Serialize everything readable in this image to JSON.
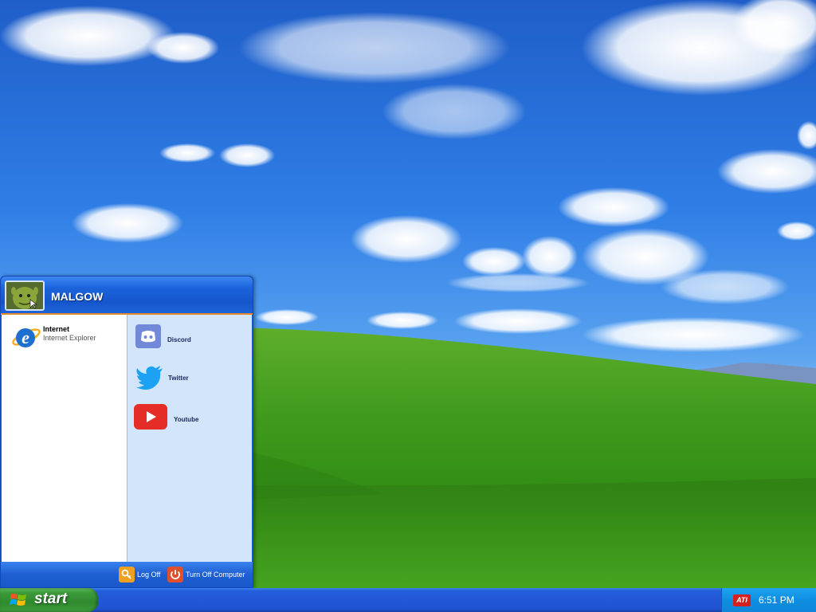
{
  "start_menu": {
    "user_name": "MALGOW",
    "pinned": [
      {
        "title": "Internet",
        "subtitle": "Internet Explorer",
        "icon": "internet-explorer-icon"
      }
    ],
    "links": [
      {
        "label": "Discord",
        "icon": "discord-icon"
      },
      {
        "label": "Twitter",
        "icon": "twitter-icon"
      },
      {
        "label": "Youtube",
        "icon": "youtube-icon"
      }
    ],
    "footer": {
      "log_off_label": "Log Off",
      "turn_off_label": "Turn Off Computer"
    }
  },
  "taskbar": {
    "start_label": "start",
    "tray_icon": "ATI",
    "clock": "6:51 PM"
  },
  "colors": {
    "start_green": "#3c9a3a",
    "taskbar_blue": "#245edb",
    "tray_blue": "#0f8ee0"
  }
}
